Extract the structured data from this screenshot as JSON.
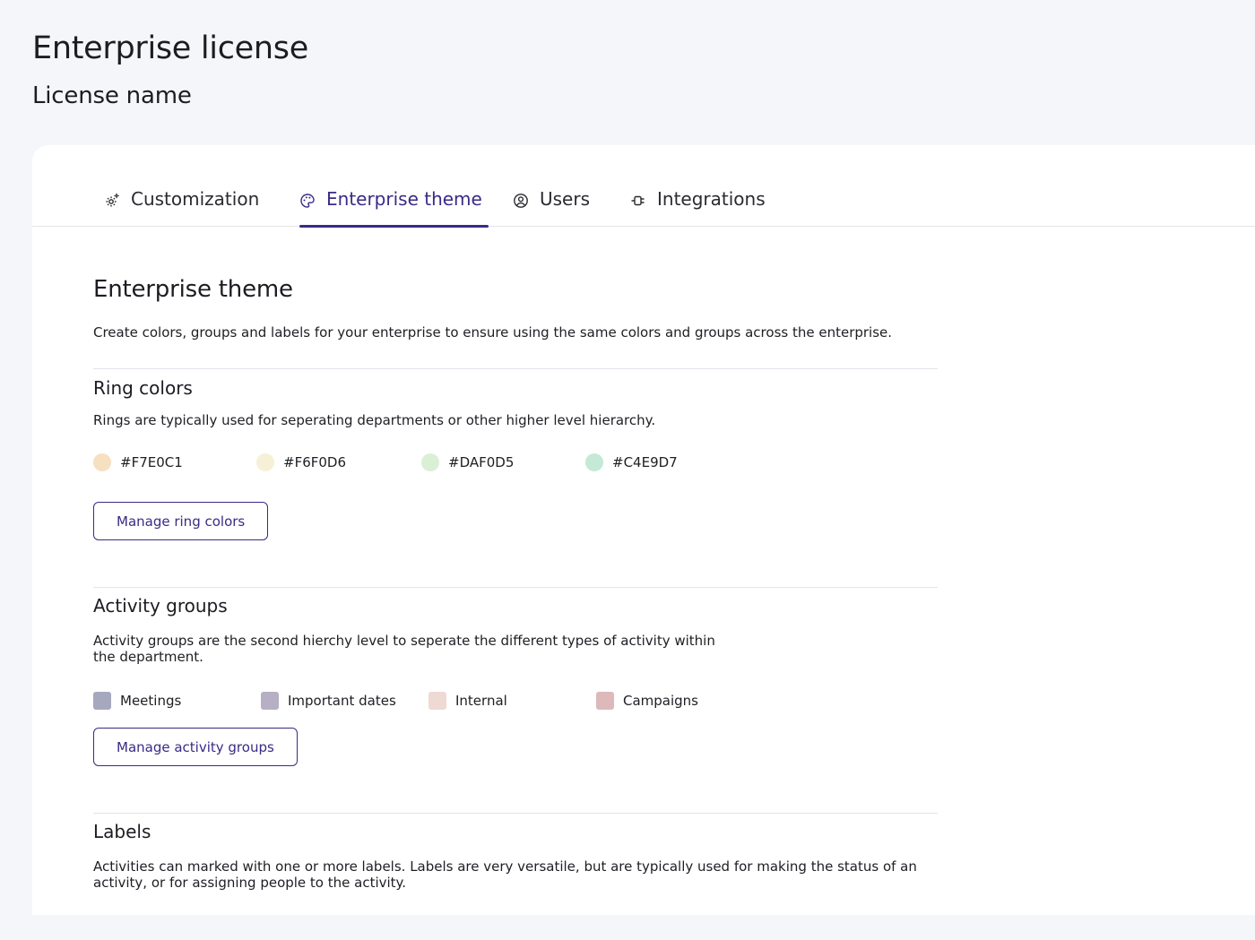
{
  "header": {
    "title": "Enterprise license",
    "subtitle": "License name"
  },
  "tabs": [
    {
      "label": "Customization",
      "icon": "gear-sparkle-icon",
      "active": false
    },
    {
      "label": "Enterprise theme",
      "icon": "palette-icon",
      "active": true
    },
    {
      "label": "Users",
      "icon": "user-circle-icon",
      "active": false
    },
    {
      "label": "Integrations",
      "icon": "plug-icon",
      "active": false
    }
  ],
  "theme": {
    "title": "Enterprise theme",
    "description": "Create colors, groups and labels for your enterprise to ensure using the same colors and groups across the enterprise."
  },
  "ring_colors": {
    "title": "Ring colors",
    "description": "Rings are typically used for seperating departments or other higher level hierarchy.",
    "items": [
      {
        "label": "#F7E0C1",
        "color": "#F7E0C1"
      },
      {
        "label": "#F6F0D6",
        "color": "#F6F0D6"
      },
      {
        "label": "#DAF0D5",
        "color": "#DAF0D5"
      },
      {
        "label": "#C4E9D7",
        "color": "#C4E9D7"
      }
    ],
    "button_label": "Manage ring colors"
  },
  "activity_groups": {
    "title": "Activity groups",
    "description": "Activity groups are the second hierchy level to seperate the different types of activity within the department.",
    "items": [
      {
        "label": "Meetings",
        "color": "#A6A8BE"
      },
      {
        "label": "Important dates",
        "color": "#B7AFC3"
      },
      {
        "label": "Internal",
        "color": "#EED9D3"
      },
      {
        "label": "Campaigns",
        "color": "#DDB9B9"
      }
    ],
    "button_label": "Manage activity groups"
  },
  "labels": {
    "title": "Labels",
    "description": "Activities can marked with one or more labels. Labels are very versatile, but are typically used for making the status of an activity, or for assigning people to the activity."
  },
  "accent_color": "#3B2A86"
}
